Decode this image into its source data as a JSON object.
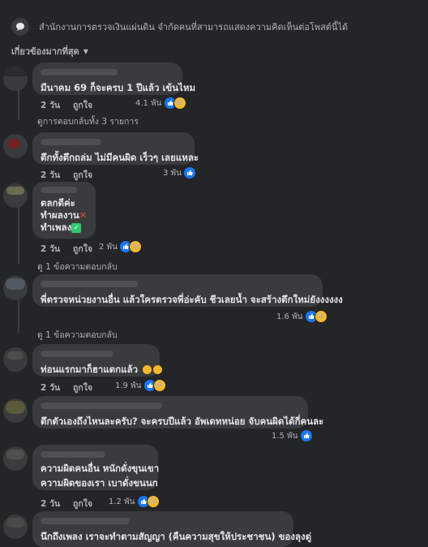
{
  "notice": {
    "text": "สำนักงานการตรวจเงินแผ่นดิน จำกัดคนที่สามารถแสดงความคิดเห็นต่อโพสต์นี้ได้"
  },
  "sort": {
    "label": "เกี่ยวข้องมากที่สุด"
  },
  "comments": [
    {
      "text": "มีนาคม 69 ก็จะครบ 1 ปีแล้ว เข้นไหม",
      "time": "2 วัน",
      "like": "ถูกใจ",
      "reactions": "4.1 พัน",
      "reply_link": "ดูการตอบกลับทั้ง 3 รายการ"
    },
    {
      "text": "ตึกทั้งตึกถล่ม ไม่มีคนผิด เร็วๆ เลยแหละ",
      "time": "2 วัน",
      "like": "ถูกใจ",
      "reactions": "3 พัน"
    },
    {
      "line1": "ตลกดีค่ะ",
      "line2": "ทำผลงาน",
      "line3": "ทำเพลง",
      "time": "2 วัน",
      "like": "ถูกใจ",
      "reactions": "2 พัน",
      "reply_link": "ดู 1 ข้อความตอบกลับ"
    },
    {
      "text": "พี่ตรวจหน่วยงานอื่น แล้วใครตรวจพี่อ่ะคับ ชีวเลยน้ำ จะสร้างตึกใหม่ยังงงงงง",
      "time": "2 วัน",
      "like": "ถูกใจ",
      "reactions": "1.6 พัน",
      "reply_link": "ดู 1 ข้อความตอบกลับ"
    },
    {
      "text": "ท่อนแรกมาก็ฮาแตกแล้ว",
      "time": "2 วัน",
      "like": "ถูกใจ",
      "reactions": "1.9 พัน"
    },
    {
      "text": "ตึกตัวเองถึงไหนละครับ? จะครบปีแล้ว อัพเดทหน่อย จับคนผิดได้กี่คนละ",
      "time": "2 วัน",
      "like": "ถูกใจ",
      "reactions": "1.5 พัน"
    },
    {
      "line1": "ความผิดคนอื่น หนักดั่งขุนเขา",
      "line2": "ความผิดของเรา เบาดั่งขนนก",
      "time": "2 วัน",
      "like": "ถูกใจ",
      "reactions": "1.2 พัน"
    },
    {
      "text": "นึกถึงเพลง เราจะทำตามสัญญา (คืนความสุขให้ประชาชน) ของลุงตู่"
    }
  ],
  "colors": {
    "bg": "#242526",
    "bubble": "#3a3b3c",
    "like_blue": "#1877f2",
    "haha_yellow": "#f7b928"
  }
}
